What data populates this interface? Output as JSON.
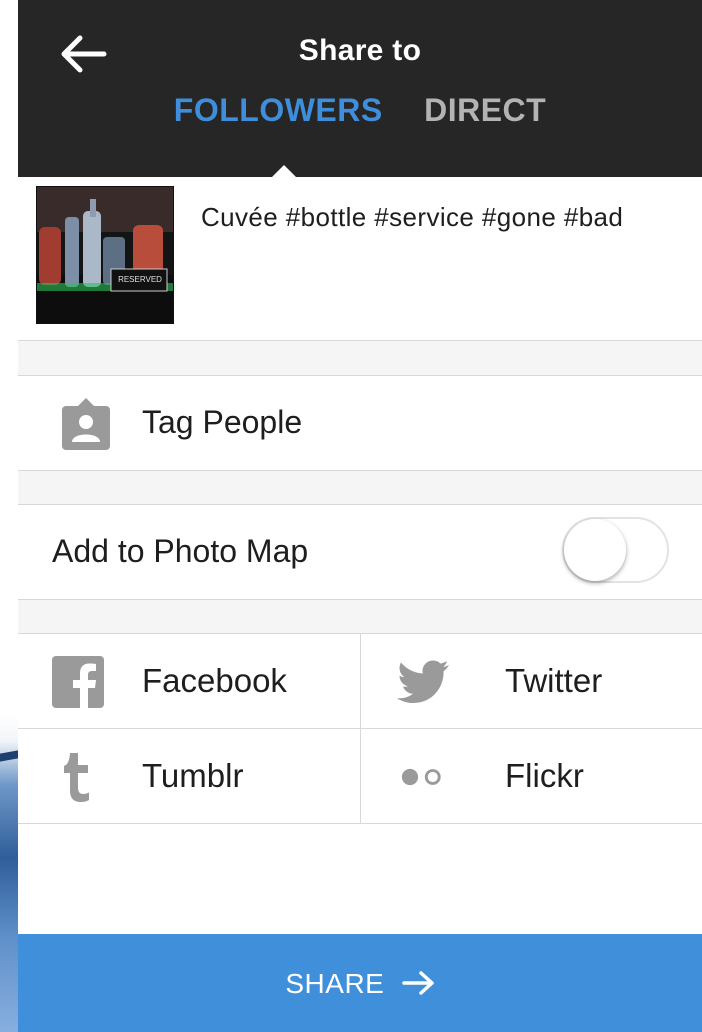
{
  "header": {
    "title": "Share to",
    "tabs": [
      {
        "label": "FOLLOWERS",
        "active": true
      },
      {
        "label": "DIRECT",
        "active": false
      }
    ]
  },
  "post": {
    "thumbnail_sign": "RESERVED",
    "caption": "Cuvée #bottle #service #gone #bad"
  },
  "options": {
    "tag_people_label": "Tag People",
    "photo_map_label": "Add to Photo Map",
    "photo_map_enabled": false
  },
  "networks": [
    {
      "label": "Facebook",
      "icon": "facebook-icon"
    },
    {
      "label": "Twitter",
      "icon": "twitter-icon"
    },
    {
      "label": "Tumblr",
      "icon": "tumblr-icon"
    },
    {
      "label": "Flickr",
      "icon": "flickr-icon"
    }
  ],
  "share": {
    "label": "SHARE"
  },
  "colors": {
    "header_bg": "#262626",
    "accent": "#3f8fdb",
    "inactive_tab": "#b3b3b3",
    "icon_gray": "#9a9a9a"
  }
}
